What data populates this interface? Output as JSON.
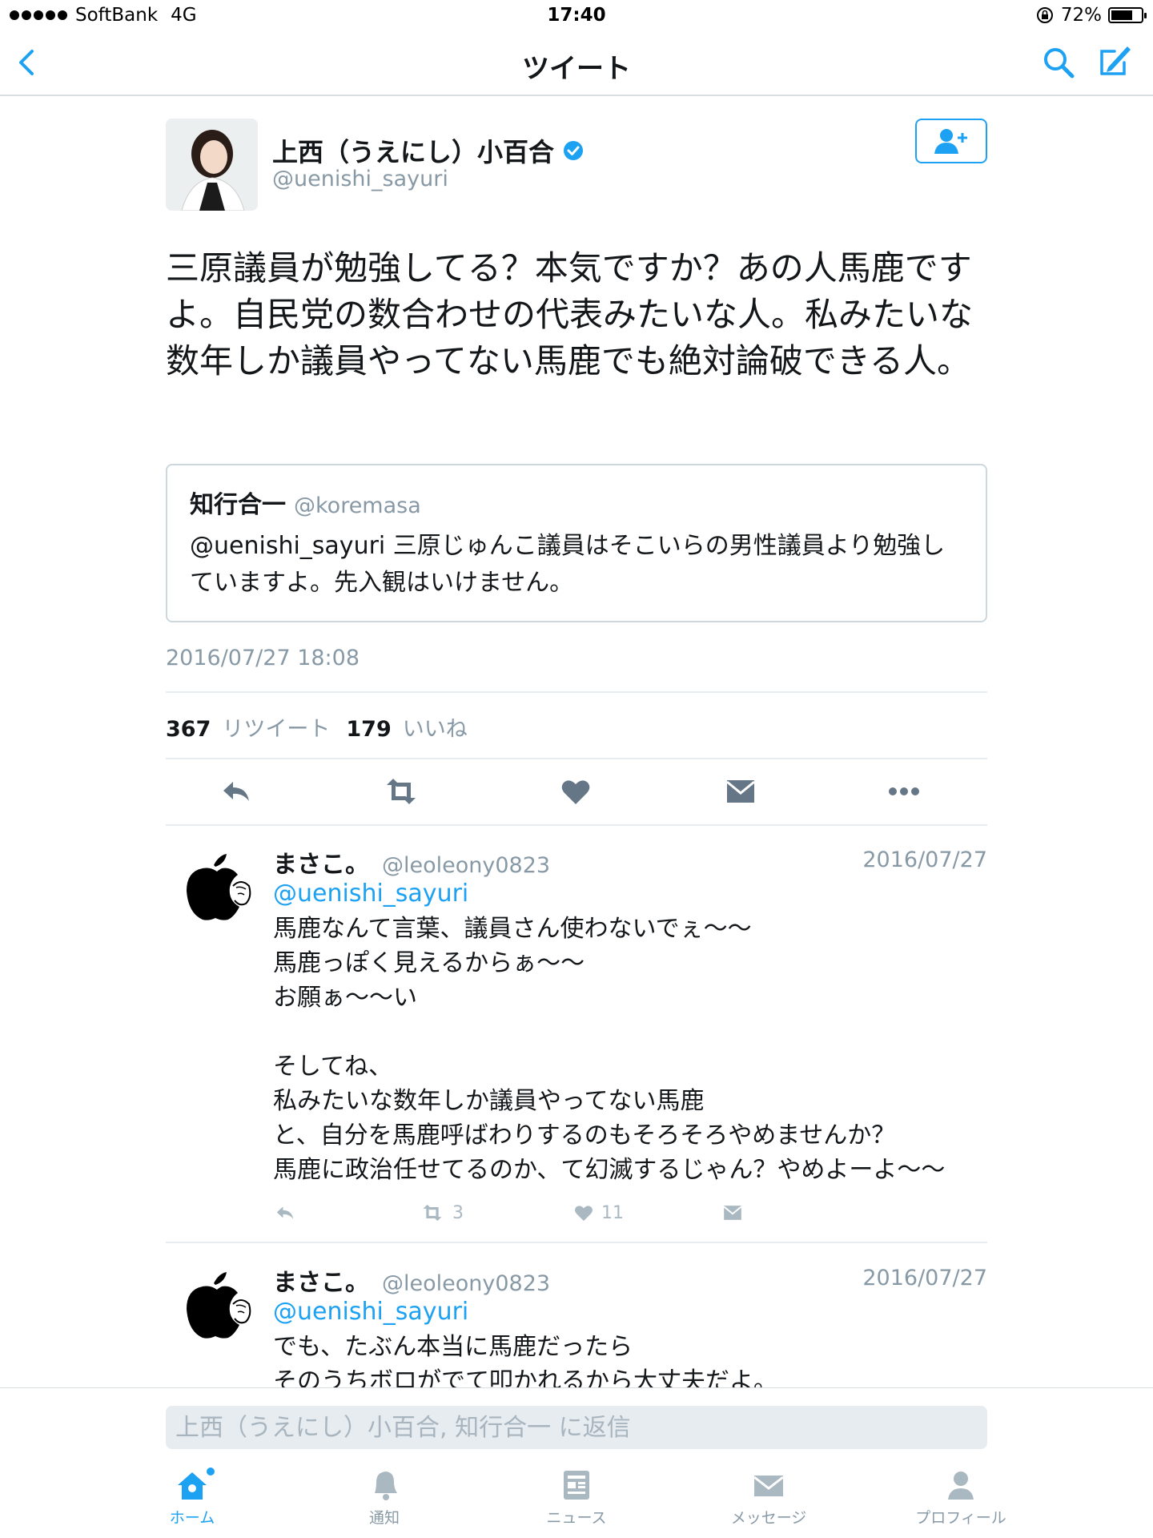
{
  "status_bar": {
    "carrier": "SoftBank",
    "network": "4G",
    "time": "17:40",
    "battery": "72%",
    "battery_level": 0.72
  },
  "nav": {
    "title": "ツイート"
  },
  "tweet": {
    "author_name": "上西（うえにし）小百合",
    "author_handle": "@uenishi_sayuri",
    "text": "三原議員が勉強してる？本気ですか？あの人馬鹿ですよ。自民党の数合わせの代表みたいな人。私みたいな数年しか議員やってない馬鹿でも絶対論破できる人。",
    "quote": {
      "name": "知行合一",
      "handle": "@koremasa",
      "text": "@uenishi_sayuri  三原じゅんこ議員はそこいらの男性議員より勉強していますよ。先入観はいけません。"
    },
    "timestamp": "2016/07/27 18:08",
    "retweet_count": "367",
    "retweet_label": "リツイート",
    "like_count": "179",
    "like_label": "いいね"
  },
  "replies": [
    {
      "name": "まさこ。",
      "handle": "@leoleony0823",
      "date": "2016/07/27",
      "mention": "@uenishi_sayuri",
      "body": "馬鹿なんて言葉、議員さん使わないでぇ〜〜\n馬鹿っぽく見えるからぁ〜〜\nお願ぁ〜〜い\n\nそしてね、\n私みたいな数年しか議員やってない馬鹿\nと、自分を馬鹿呼ばわりするのもそろそろやめませんか？\n馬鹿に政治任せてるのか、て幻滅するじゃん？やめよーよ〜〜",
      "retweets": "3",
      "likes": "11"
    },
    {
      "name": "まさこ。",
      "handle": "@leoleony0823",
      "date": "2016/07/27",
      "mention": "@uenishi_sayuri",
      "body": "でも、たぶん本当に馬鹿だったら\nそのうちボロがでて叩かれるから大丈夫だよ。"
    }
  ],
  "reply_box": {
    "placeholder": "上西（うえにし）小百合, 知行合一 に返信"
  },
  "tabs": [
    {
      "label": "ホーム",
      "icon": "home-icon",
      "active": true
    },
    {
      "label": "通知",
      "icon": "bell-icon"
    },
    {
      "label": "ニュース",
      "icon": "news-icon"
    },
    {
      "label": "メッセージ",
      "icon": "envelope-icon"
    },
    {
      "label": "プロフィール",
      "icon": "person-icon"
    }
  ],
  "colors": {
    "accent": "#1da1f2",
    "muted": "#8899a6",
    "icon_gray": "#aab8c2"
  }
}
